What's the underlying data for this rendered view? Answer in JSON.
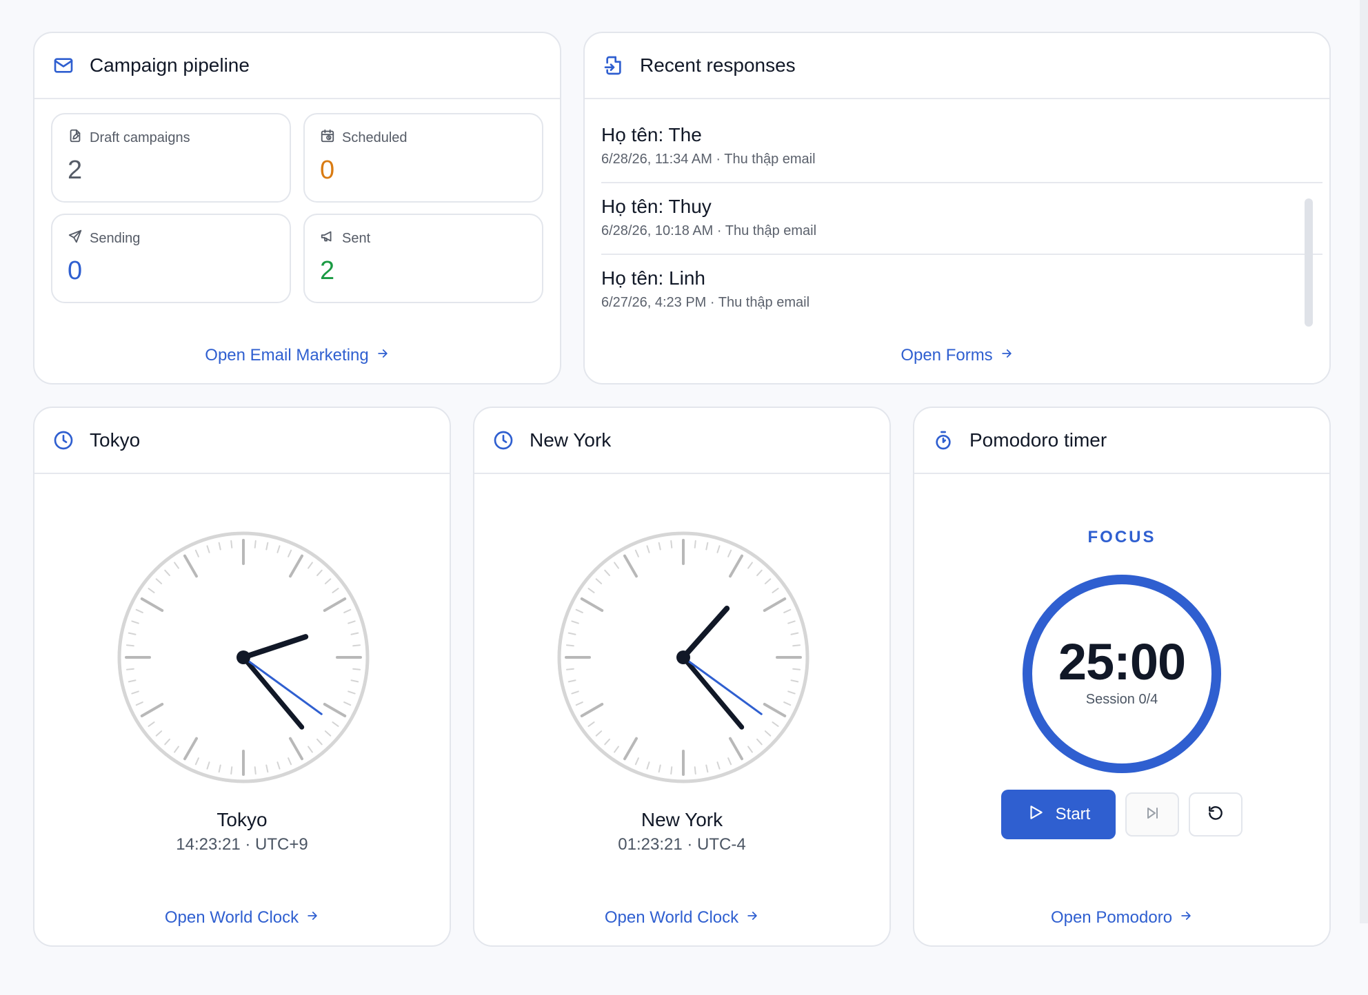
{
  "colors": {
    "accent": "#2f5fd0",
    "amber": "#d97b12",
    "green": "#1a9a43",
    "neutral_value": "#555b66"
  },
  "campaign": {
    "title": "Campaign pipeline",
    "icon": "mail-icon",
    "stats": [
      {
        "label": "Draft campaigns",
        "value": "2",
        "icon": "file-icon",
        "color": "#555b66"
      },
      {
        "label": "Scheduled",
        "value": "0",
        "icon": "calendar-clock-icon",
        "color": "#d97b12"
      },
      {
        "label": "Sending",
        "value": "0",
        "icon": "send-icon",
        "color": "#2f5fd0"
      },
      {
        "label": "Sent",
        "value": "2",
        "icon": "megaphone-icon",
        "color": "#1a9a43"
      }
    ],
    "link": "Open Email Marketing"
  },
  "responses": {
    "title": "Recent responses",
    "icon": "file-import-icon",
    "items": [
      {
        "title": "Họ tên: The",
        "meta": "6/28/26, 11:34 AM · Thu thập email"
      },
      {
        "title": "Họ tên: Thuy",
        "meta": "6/28/26, 10:18 AM · Thu thập email"
      },
      {
        "title": "Họ tên: Linh",
        "meta": "6/27/26, 4:23 PM · Thu thập email"
      }
    ],
    "link": "Open Forms"
  },
  "clocks": [
    {
      "title": "Tokyo",
      "name": "Tokyo",
      "meta": "14:23:21 · UTC+9",
      "time": {
        "h": 14,
        "m": 23,
        "s": 21
      },
      "link": "Open World Clock"
    },
    {
      "title": "New York",
      "name": "New York",
      "meta": "01:23:21 · UTC-4",
      "time": {
        "h": 1,
        "m": 23,
        "s": 21
      },
      "link": "Open World Clock"
    }
  ],
  "pomodoro": {
    "title": "Pomodoro timer",
    "icon": "timer-icon",
    "mode": "FOCUS",
    "time": "25:00",
    "session": "Session 0/4",
    "progress": 1.0,
    "start_label": "Start",
    "link": "Open Pomodoro"
  }
}
